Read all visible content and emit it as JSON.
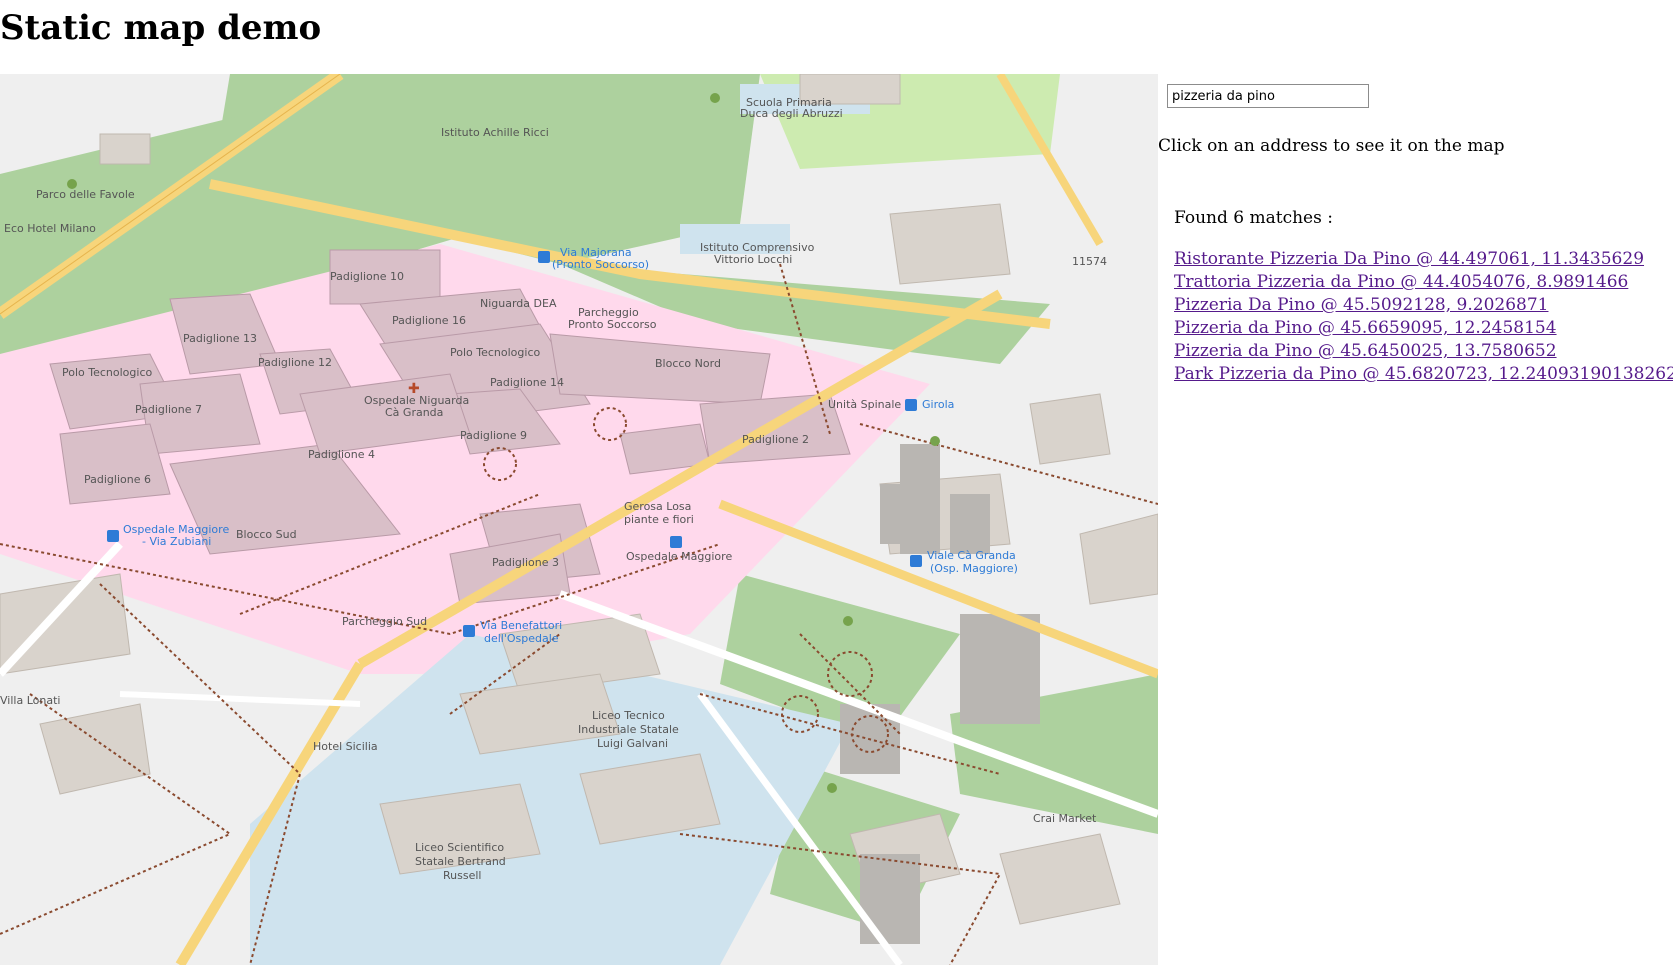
{
  "page": {
    "title": "Static map demo"
  },
  "search": {
    "value": "pizzeria da pino"
  },
  "hint": "Click on an address to see it on the map",
  "results": {
    "summary": "Found 6 matches :",
    "items": [
      {
        "label": "Ristorante Pizzeria Da Pino @ 44.497061, 11.3435629"
      },
      {
        "label": "Trattoria Pizzeria da Pino @ 44.4054076, 8.9891466"
      },
      {
        "label": "Pizzeria Da Pino @ 45.5092128, 9.2026871"
      },
      {
        "label": "Pizzeria da Pino @ 45.6659095, 12.2458154"
      },
      {
        "label": "Pizzeria da Pino @ 45.6450025, 13.7580652"
      },
      {
        "label": "Park Pizzeria da Pino @ 45.6820723, 12.240931901382622"
      }
    ]
  },
  "map": {
    "labels": {
      "padiglione_10": "Padiglione 10",
      "niguarda_dea": "Niguarda DEA",
      "padiglione_13": "Padiglione 13",
      "padiglione_16": "Padiglione 16",
      "parcheggio_ps": "Parcheggio",
      "pronto_soccorso": "Pronto Soccorso",
      "polo_tecnologico": "Polo Tecnologico",
      "polo_tecnologico_2": "Polo Tecnologico",
      "padiglione_12": "Padiglione 12",
      "blocco_nord": "Blocco Nord",
      "padiglione_14": "Padiglione 14",
      "ospedale_niguarda": "Ospedale Niguarda",
      "ca_granda": "Cà Granda",
      "padiglione_7": "Padiglione 7",
      "padiglione_9": "Padiglione 9",
      "padiglione_2": "Padiglione 2",
      "padiglione_4": "Padiglione 4",
      "padiglione_6": "Padiglione 6",
      "gerosa_1": "Gerosa Losa",
      "gerosa_2": "piante e fiori",
      "ospedale_maggiore": "Ospedale Maggiore",
      "blocco_sud": "Blocco Sud",
      "padiglione_3": "Padiglione 3",
      "parcheggio_sud": "Parcheggio Sud",
      "liceo_t1": "Liceo Tecnico",
      "liceo_t2": "Industriale Statale",
      "liceo_t3": "Luigi Galvani",
      "liceo_s1": "Liceo Scientifico",
      "liceo_s2": "Statale Bertrand",
      "liceo_s3": "Russell",
      "hotel_sicilia": "Hotel Sicilia",
      "villa_lonati": "Villa Lonati",
      "crai": "Crai Market",
      "parco_favole": "Parco delle Favole",
      "eco_hotel": "Eco Hotel Milano",
      "achille_ricci": "Istituto Achille Ricci",
      "scuola_1": "Scuola Primaria",
      "scuola_2": "Duca degli Abruzzi",
      "comprensivo_1": "Istituto Comprensivo",
      "comprensivo_2": "Vittorio Locchi",
      "unita_spinale": "Unità Spinale",
      "road_11574": "11574",
      "ospedale_maggiore_stop_1": "Ospedale Maggiore",
      "ospedale_maggiore_stop_2": "- Via Zubiani",
      "majorana_1": "Via Majorana",
      "majorana_2": "(Pronto Soccorso)",
      "girola": "Girola",
      "viale_ca_granda_1": "Viale Cà Granda",
      "viale_ca_granda_2": "(Osp. Maggiore)",
      "benefattori_1": "Via Benefattori",
      "benefattori_2": "dell'Ospedale"
    }
  }
}
